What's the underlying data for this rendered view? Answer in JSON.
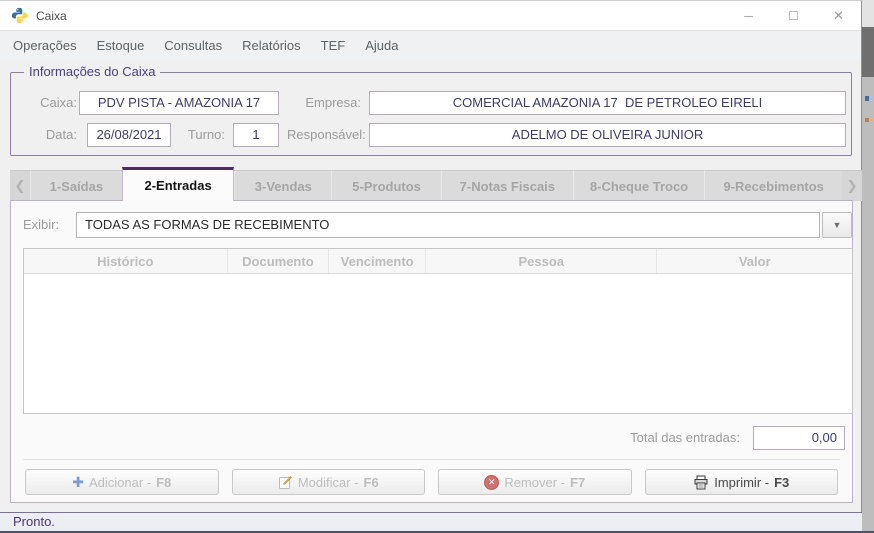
{
  "window": {
    "title": "Caixa",
    "controls": {
      "minimize": "─",
      "maximize": "☐",
      "close": "✕"
    }
  },
  "menu": {
    "items": [
      "Operações",
      "Estoque",
      "Consultas",
      "Relatórios",
      "TEF",
      "Ajuda"
    ]
  },
  "info": {
    "title": "Informações do Caixa",
    "caixa_label": "Caixa:",
    "caixa_value": "PDV PISTA - AMAZONIA 17",
    "empresa_label": "Empresa:",
    "empresa_value": "COMERCIAL AMAZONIA 17  DE PETROLEO EIRELI",
    "data_label": "Data:",
    "data_value": "26/08/2021",
    "turno_label": "Turno:",
    "turno_value": "1",
    "responsavel_label": "Responsável:",
    "responsavel_value": "ADELMO DE OLIVEIRA JUNIOR"
  },
  "tabs": {
    "scroll_left": "❮",
    "scroll_right": "❯",
    "items": [
      {
        "label": "1-Saídas",
        "active": false
      },
      {
        "label": "2-Entradas",
        "active": true
      },
      {
        "label": "3-Vendas",
        "active": false
      },
      {
        "label": "5-Produtos",
        "active": false
      },
      {
        "label": "7-Notas Fiscais",
        "active": false
      },
      {
        "label": "8-Cheque Troco",
        "active": false
      },
      {
        "label": "9-Recebimentos",
        "active": false
      }
    ]
  },
  "entradas": {
    "filter_label": "Exibir:",
    "filter_value": "TODAS AS FORMAS DE RECEBIMENTO",
    "dropdown_arrow": "▼",
    "table": {
      "columns": [
        "Histórico",
        "Documento",
        "Vencimento",
        "Pessoa",
        "Valor"
      ],
      "rows": []
    },
    "total_label": "Total das entradas:",
    "total_value": "0,00",
    "buttons": [
      {
        "label": "Adicionar - ",
        "key": "F8",
        "icon": "plus-icon",
        "enabled": false
      },
      {
        "label": "Modificar - ",
        "key": "F6",
        "icon": "edit-icon",
        "enabled": false
      },
      {
        "label": "Remover - ",
        "key": "F7",
        "icon": "remove-icon",
        "enabled": false
      },
      {
        "label": "Imprimir - ",
        "key": "F3",
        "icon": "print-icon",
        "enabled": true
      }
    ]
  },
  "status": {
    "text": "Pronto."
  },
  "colors": {
    "accent_purple": "#4f2a60",
    "groupbox_border": "#8e7ea6",
    "value_text": "#3b3b6d",
    "status_text": "#4a3570",
    "disabled_text": "#bdbdbd",
    "header_text": "#bcbcbc"
  }
}
